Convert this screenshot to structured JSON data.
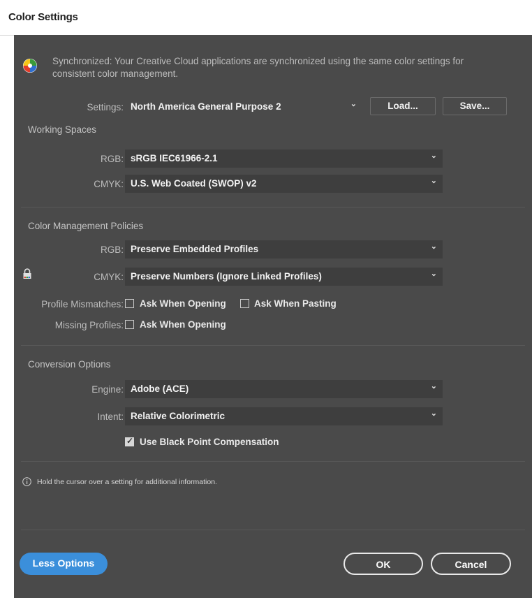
{
  "window": {
    "title": "Color Settings"
  },
  "sync": {
    "message_line1": "Synchronized: Your Creative Cloud applications are synchronized using the same color settings for",
    "message_line2": "consistent color management."
  },
  "settings": {
    "label": "Settings:",
    "value": "North America General Purpose 2",
    "load_label": "Load...",
    "save_label": "Save..."
  },
  "working_spaces": {
    "title": "Working Spaces",
    "rgb_label": "RGB:",
    "rgb_value": "sRGB IEC61966-2.1",
    "cmyk_label": "CMYK:",
    "cmyk_value": "U.S. Web Coated (SWOP) v2"
  },
  "policies": {
    "title": "Color Management Policies",
    "rgb_label": "RGB:",
    "rgb_value": "Preserve Embedded Profiles",
    "cmyk_label": "CMYK:",
    "cmyk_value": "Preserve Numbers (Ignore Linked Profiles)",
    "mismatch_label": "Profile Mismatches:",
    "mismatch_opening": "Ask When Opening",
    "mismatch_opening_checked": false,
    "mismatch_pasting": "Ask When Pasting",
    "mismatch_pasting_checked": false,
    "missing_label": "Missing Profiles:",
    "missing_opening": "Ask When Opening",
    "missing_opening_checked": false
  },
  "conversion": {
    "title": "Conversion Options",
    "engine_label": "Engine:",
    "engine_value": "Adobe (ACE)",
    "intent_label": "Intent:",
    "intent_value": "Relative Colorimetric",
    "bpc_label": "Use Black Point Compensation",
    "bpc_checked": true
  },
  "info": {
    "text": "Hold the cursor over a setting for additional information."
  },
  "footer": {
    "less_options": "Less Options",
    "ok": "OK",
    "cancel": "Cancel"
  },
  "colors": {
    "panel": "#4a4a4a",
    "accent": "#3b8fdb"
  }
}
